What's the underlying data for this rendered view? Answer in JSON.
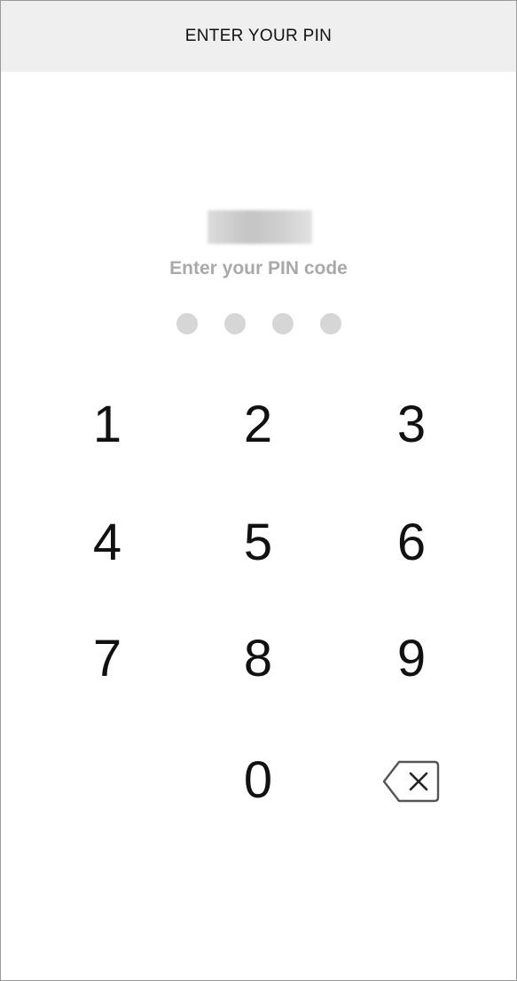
{
  "header": {
    "title": "ENTER YOUR PIN"
  },
  "pin": {
    "prompt": "Enter your PIN code",
    "entered_digits": 0,
    "total_digits": 4
  },
  "keypad": {
    "keys": [
      "1",
      "2",
      "3",
      "4",
      "5",
      "6",
      "7",
      "8",
      "9",
      "0"
    ],
    "backspace_icon": "backspace-icon"
  },
  "colors": {
    "header_bg": "#efefef",
    "prompt_text": "#a9a9a9",
    "dot_empty": "#d6d6d6",
    "key_text": "#111111"
  }
}
